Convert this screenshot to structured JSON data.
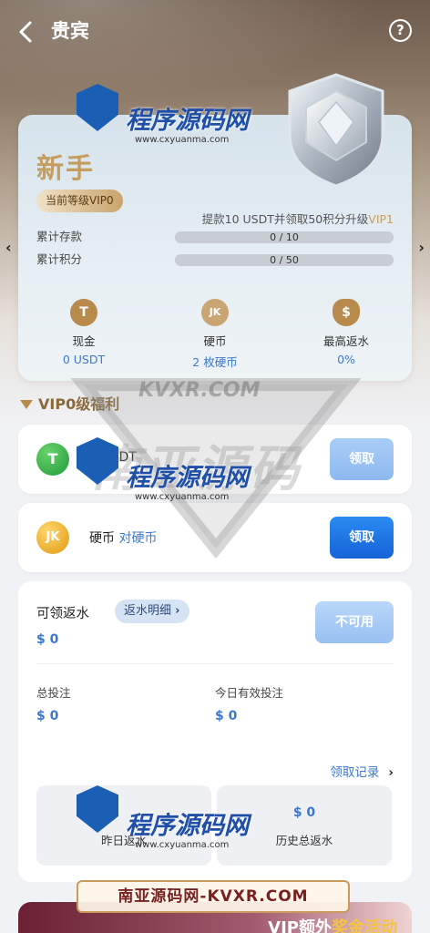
{
  "header": {
    "back_icon": "chevron-left-icon",
    "title": "贵宾",
    "help_icon": "?"
  },
  "level_card": {
    "level_name": "新手",
    "current_level": "当前等级VIP0",
    "upgrade_text": "提款10 USDT并领取50积分升级",
    "upgrade_target": "VIP1",
    "deposit": {
      "label": "累计存款",
      "text": "0 / 10",
      "progress": 0
    },
    "points": {
      "label": "累计积分",
      "text": "0 / 50",
      "progress": 0
    },
    "stats": [
      {
        "icon": "T",
        "label": "现金",
        "value": "0 USDT"
      },
      {
        "icon": "JK",
        "label": "硬币",
        "value": "2 枚硬币"
      },
      {
        "icon": "$",
        "label": "最高返水",
        "value": "0%"
      }
    ]
  },
  "benefits": {
    "title": "VIP0级福利",
    "rows": [
      {
        "icon": "T",
        "label": "0 USDT",
        "link": "",
        "button": "领取"
      },
      {
        "icon": "JK",
        "label": "硬币",
        "link": "对硬币",
        "button": "领取"
      }
    ]
  },
  "rebate": {
    "title": "可领返水",
    "detail": "返水明细",
    "amount": "$ 0",
    "button": "不可用",
    "total_bet_label": "总投注",
    "total_bet": "$ 0",
    "today_valid_label": "今日有效投注",
    "today_valid": "$ 0",
    "record": "领取记录",
    "yesterday_value": "",
    "yesterday_label": "昨日返水",
    "history_value": "$ 0",
    "history_label": "历史总返水"
  },
  "promo": {
    "prefix": "VIP额外",
    "highlight": "奖金活动"
  },
  "watermarks": {
    "brand": "程序源码网",
    "url": "www.cxyuanma.com",
    "banner": "南亚源码网-KVXR.COM",
    "kvxr": "KVXR.COM",
    "big": "南亚源码"
  },
  "colors": {
    "gold": "#c59d5f",
    "blue": "#3a79d0",
    "button": "#1f75e6"
  }
}
